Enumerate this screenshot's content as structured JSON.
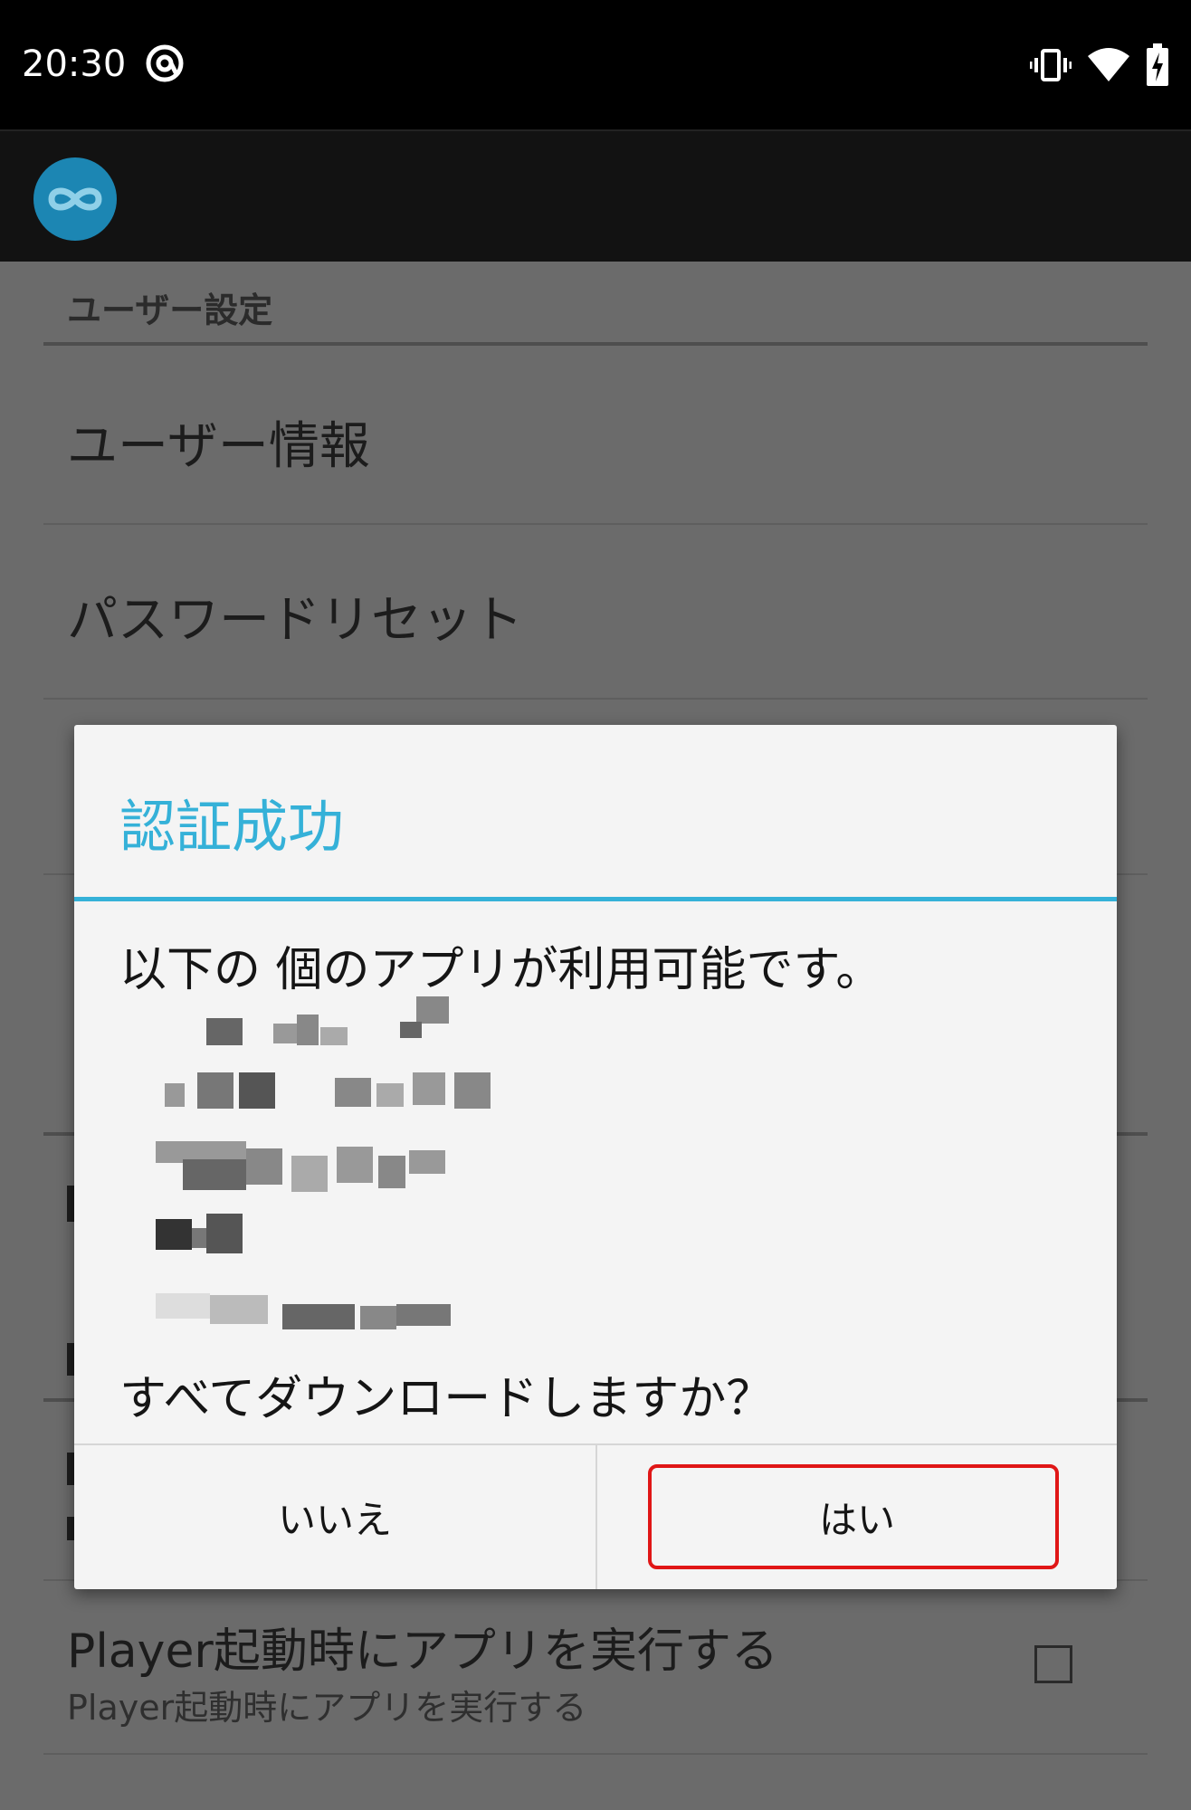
{
  "status_bar": {
    "time": "20:30",
    "icons": [
      "at-sign-icon",
      "vibrate-icon",
      "wifi-icon",
      "battery-charging-icon"
    ]
  },
  "app_bar": {
    "logo_icon": "infinity-logo-icon",
    "logo_color": "#1c86b3"
  },
  "settings": {
    "category": "ユーザー設定",
    "items": [
      {
        "title": "ユーザー情報"
      },
      {
        "title": "パスワードリセット"
      }
    ],
    "autorun": {
      "title": "Player起動時にアプリを実行する",
      "subtitle": "Player起動時にアプリを実行する",
      "checked": false
    }
  },
  "dialog": {
    "title": "認証成功",
    "message": "以下の 個のアプリが利用可能です。",
    "question": "すべてダウンロードしますか？",
    "buttons": {
      "negative": "いいえ",
      "positive": "はい"
    },
    "accent_color": "#35b1d8",
    "highlight_color": "#e01616"
  }
}
